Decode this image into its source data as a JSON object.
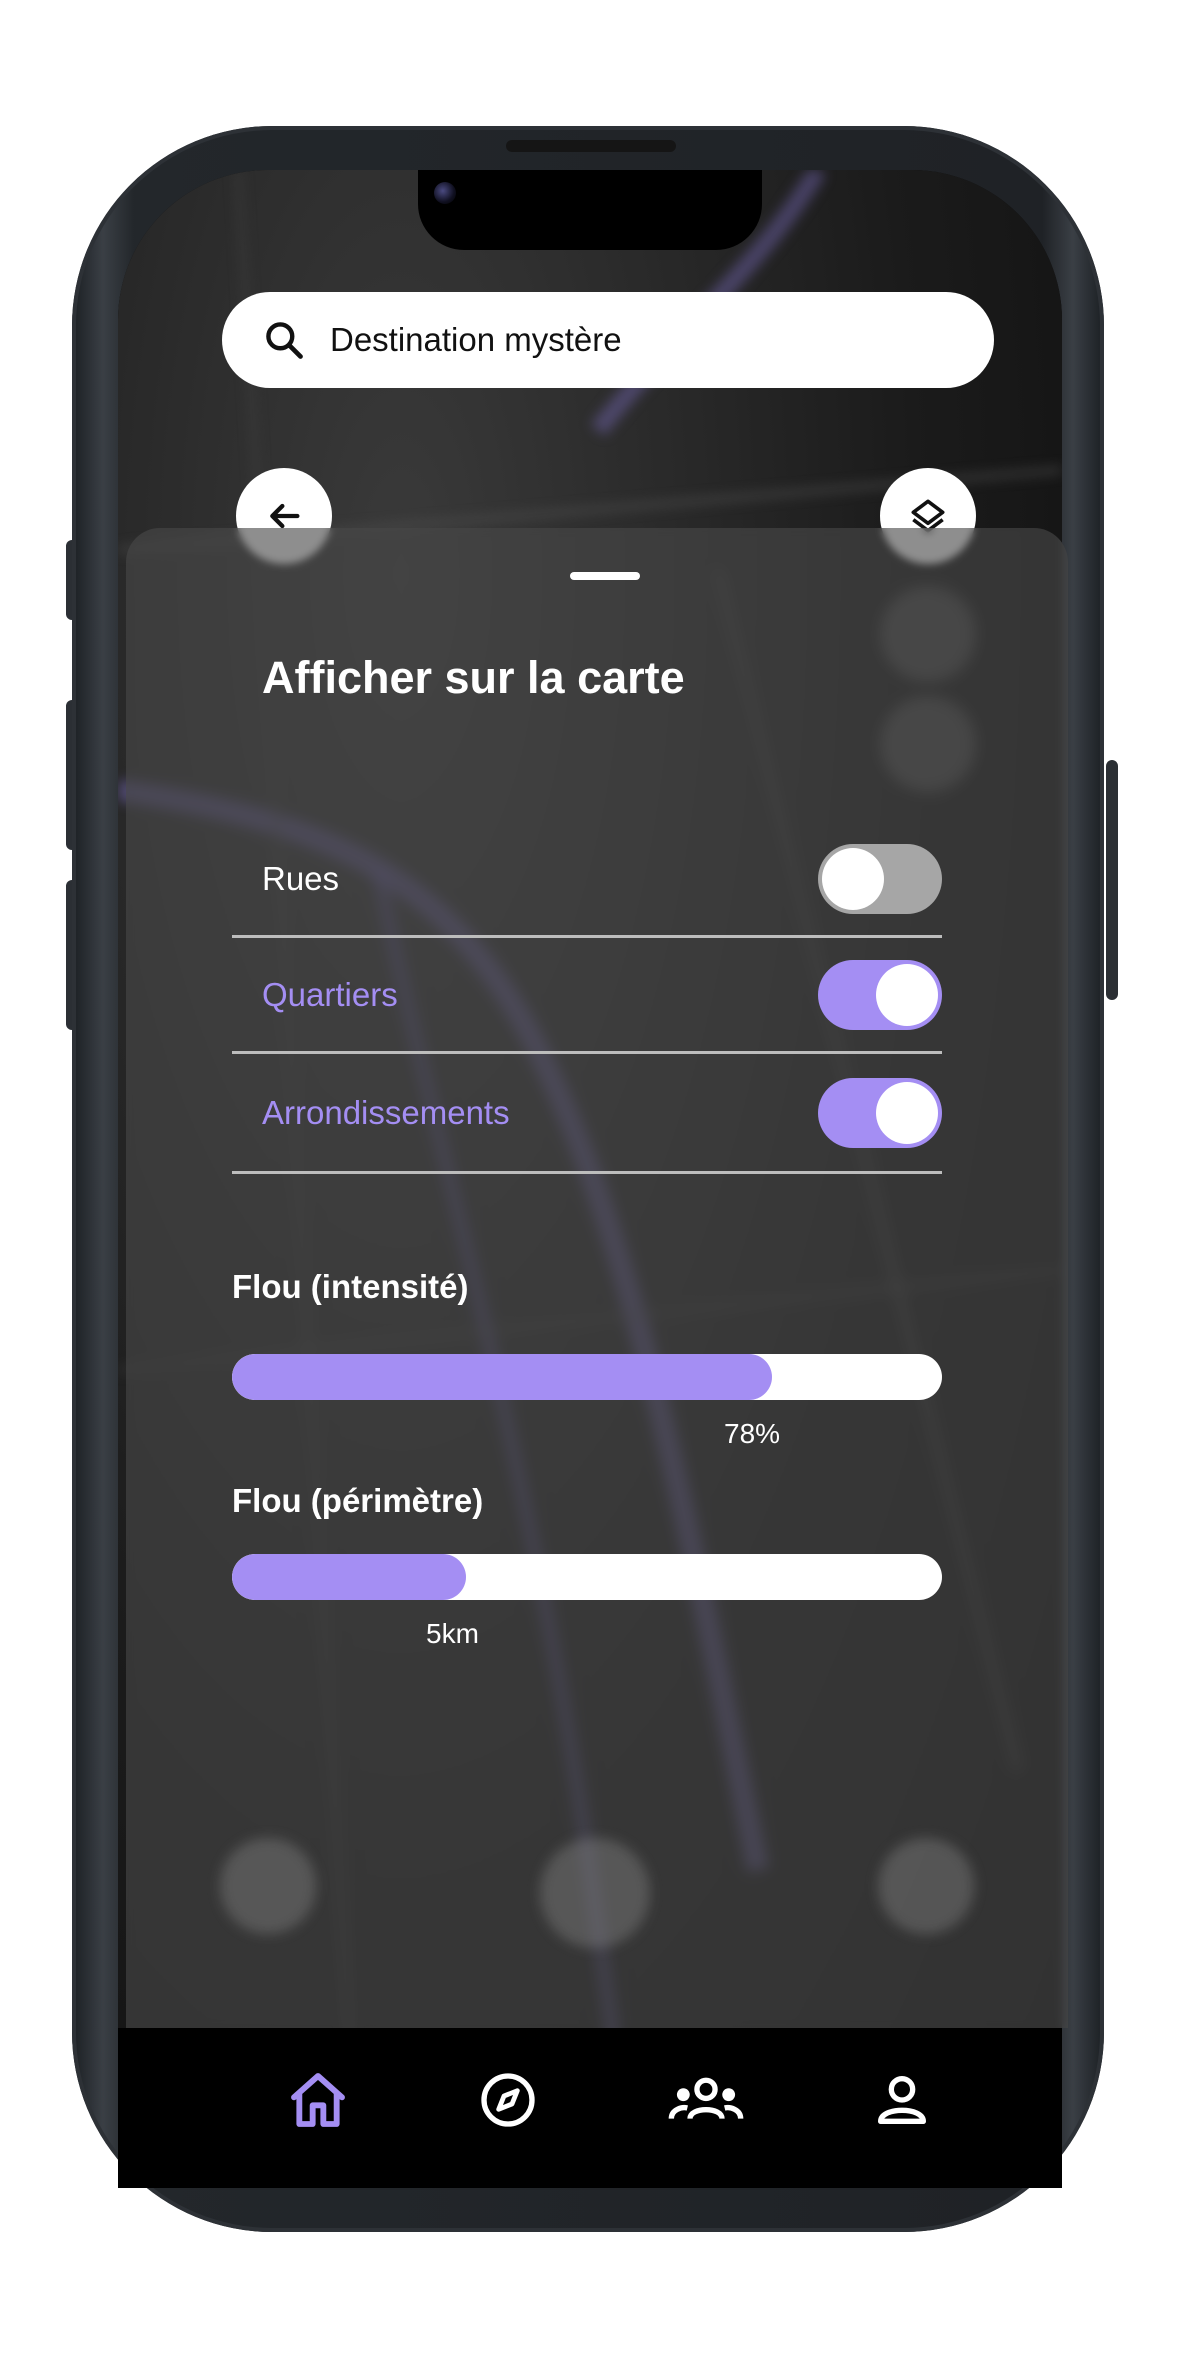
{
  "search": {
    "value": "Destination mystère",
    "icon": "search-icon"
  },
  "map_controls": {
    "back_icon": "arrow-left-icon",
    "layers_icon": "layers-icon"
  },
  "panel": {
    "title": "Afficher sur la carte",
    "toggles": [
      {
        "label": "Rues",
        "state": "off"
      },
      {
        "label": "Quartiers",
        "state": "on"
      },
      {
        "label": "Arrondissements",
        "state": "on"
      }
    ],
    "sliders": [
      {
        "label": "Flou (intensité)",
        "value_text": "78%",
        "level": 0.76
      },
      {
        "label": "Flou (périmètre)",
        "value_text": "5km",
        "level": 0.33
      }
    ]
  },
  "nav": {
    "items": [
      {
        "icon": "home-icon",
        "active": true
      },
      {
        "icon": "compass-icon",
        "active": false
      },
      {
        "icon": "group-icon",
        "active": false
      },
      {
        "icon": "profile-icon",
        "active": false
      }
    ]
  },
  "colors": {
    "accent": "#a48ef3",
    "toggle_off": "#a6a6a6",
    "panel": "#484848"
  }
}
